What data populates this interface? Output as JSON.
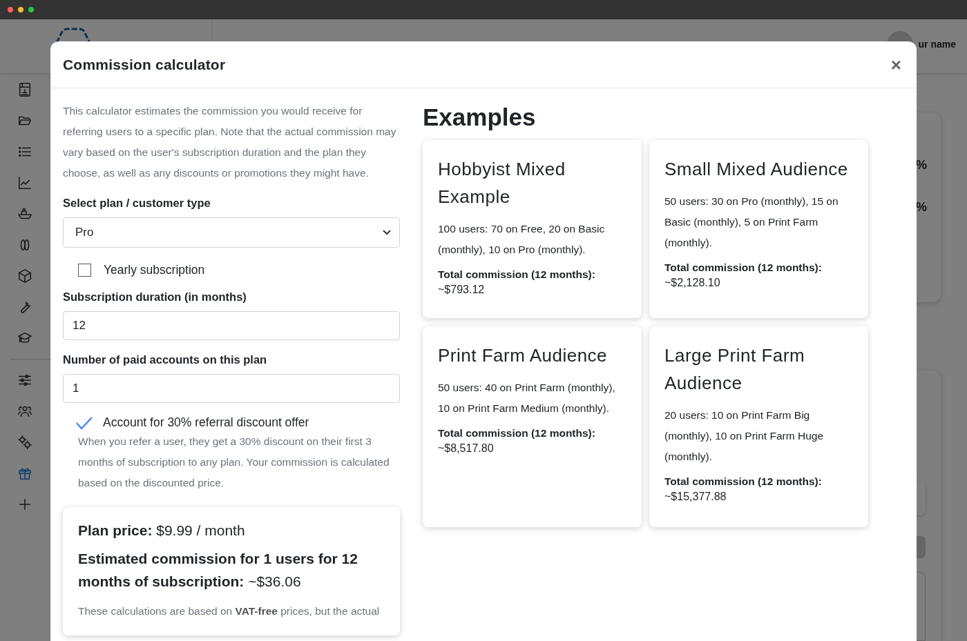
{
  "background": {
    "user_name": "ur name",
    "sidebar": {
      "items": [
        {
          "selected": false
        },
        {
          "selected": false
        },
        {
          "selected": false
        },
        {
          "selected": false
        },
        {
          "selected": false
        },
        {
          "selected": false
        },
        {
          "selected": false
        },
        {
          "selected": false
        },
        {
          "selected": false
        },
        {
          "selected": false
        },
        {
          "selected": false
        },
        {
          "selected": false
        },
        {
          "selected": true
        },
        {
          "selected": false
        }
      ]
    },
    "stats": [
      {
        "value": "%"
      },
      {
        "value": "%"
      }
    ]
  },
  "modal": {
    "title": "Commission calculator",
    "close": "×",
    "description": "This calculator estimates the commission you would receive for referring users to a specific plan. Note that the actual commission may vary based on the user's subscription duration and the plan they choose, as well as any discounts or promotions they might have.",
    "plan_select": {
      "label": "Select plan / customer type",
      "value": "Pro"
    },
    "yearly": {
      "label": "Yearly subscription",
      "checked": false
    },
    "duration": {
      "label": "Subscription duration (in months)",
      "value": "12"
    },
    "accounts": {
      "label": "Number of paid accounts on this plan",
      "value": "1"
    },
    "referral": {
      "label": "Account for 30% referral discount offer",
      "checked": true,
      "note": "When you refer a user, they get a 30% discount on their first 3 months of subscription to any plan. Your commission is calculated based on the discounted price."
    },
    "result": {
      "price_label": "Plan price:",
      "price": "$9.99 / month",
      "commission_label": "Estimated commission for 1 users for 12 months of subscription:",
      "commission": "~$36.06",
      "note": "These calculations are based on **VAT-free** prices, but the actual"
    },
    "examples_heading": "Examples",
    "examples": [
      {
        "title": "Hobbyist Mixed Example",
        "description": "100 users: 70 on Free, 20 on Basic (monthly), 10 on Pro (monthly).",
        "total_label": "Total commission (12 months):",
        "total": "~$793.12"
      },
      {
        "title": "Small Mixed Audience",
        "description": "50 users: 30 on Pro (monthly), 15 on Basic (monthly), 5 on Print Farm (monthly).",
        "total_label": "Total commission (12 months):",
        "total": "~$2,128.10"
      },
      {
        "title": "Print Farm Audience",
        "description": "50 users: 40 on Print Farm (monthly), 10 on Print Farm Medium (monthly).",
        "total_label": "Total commission (12 months):",
        "total": "~$8,517.80"
      },
      {
        "title": "Large Print Farm Audience",
        "description": "20 users: 10 on Print Farm Big (monthly), 10 on Print Farm Huge (monthly).",
        "total_label": "Total commission (12 months):",
        "total": "~$15,377.88"
      }
    ]
  }
}
